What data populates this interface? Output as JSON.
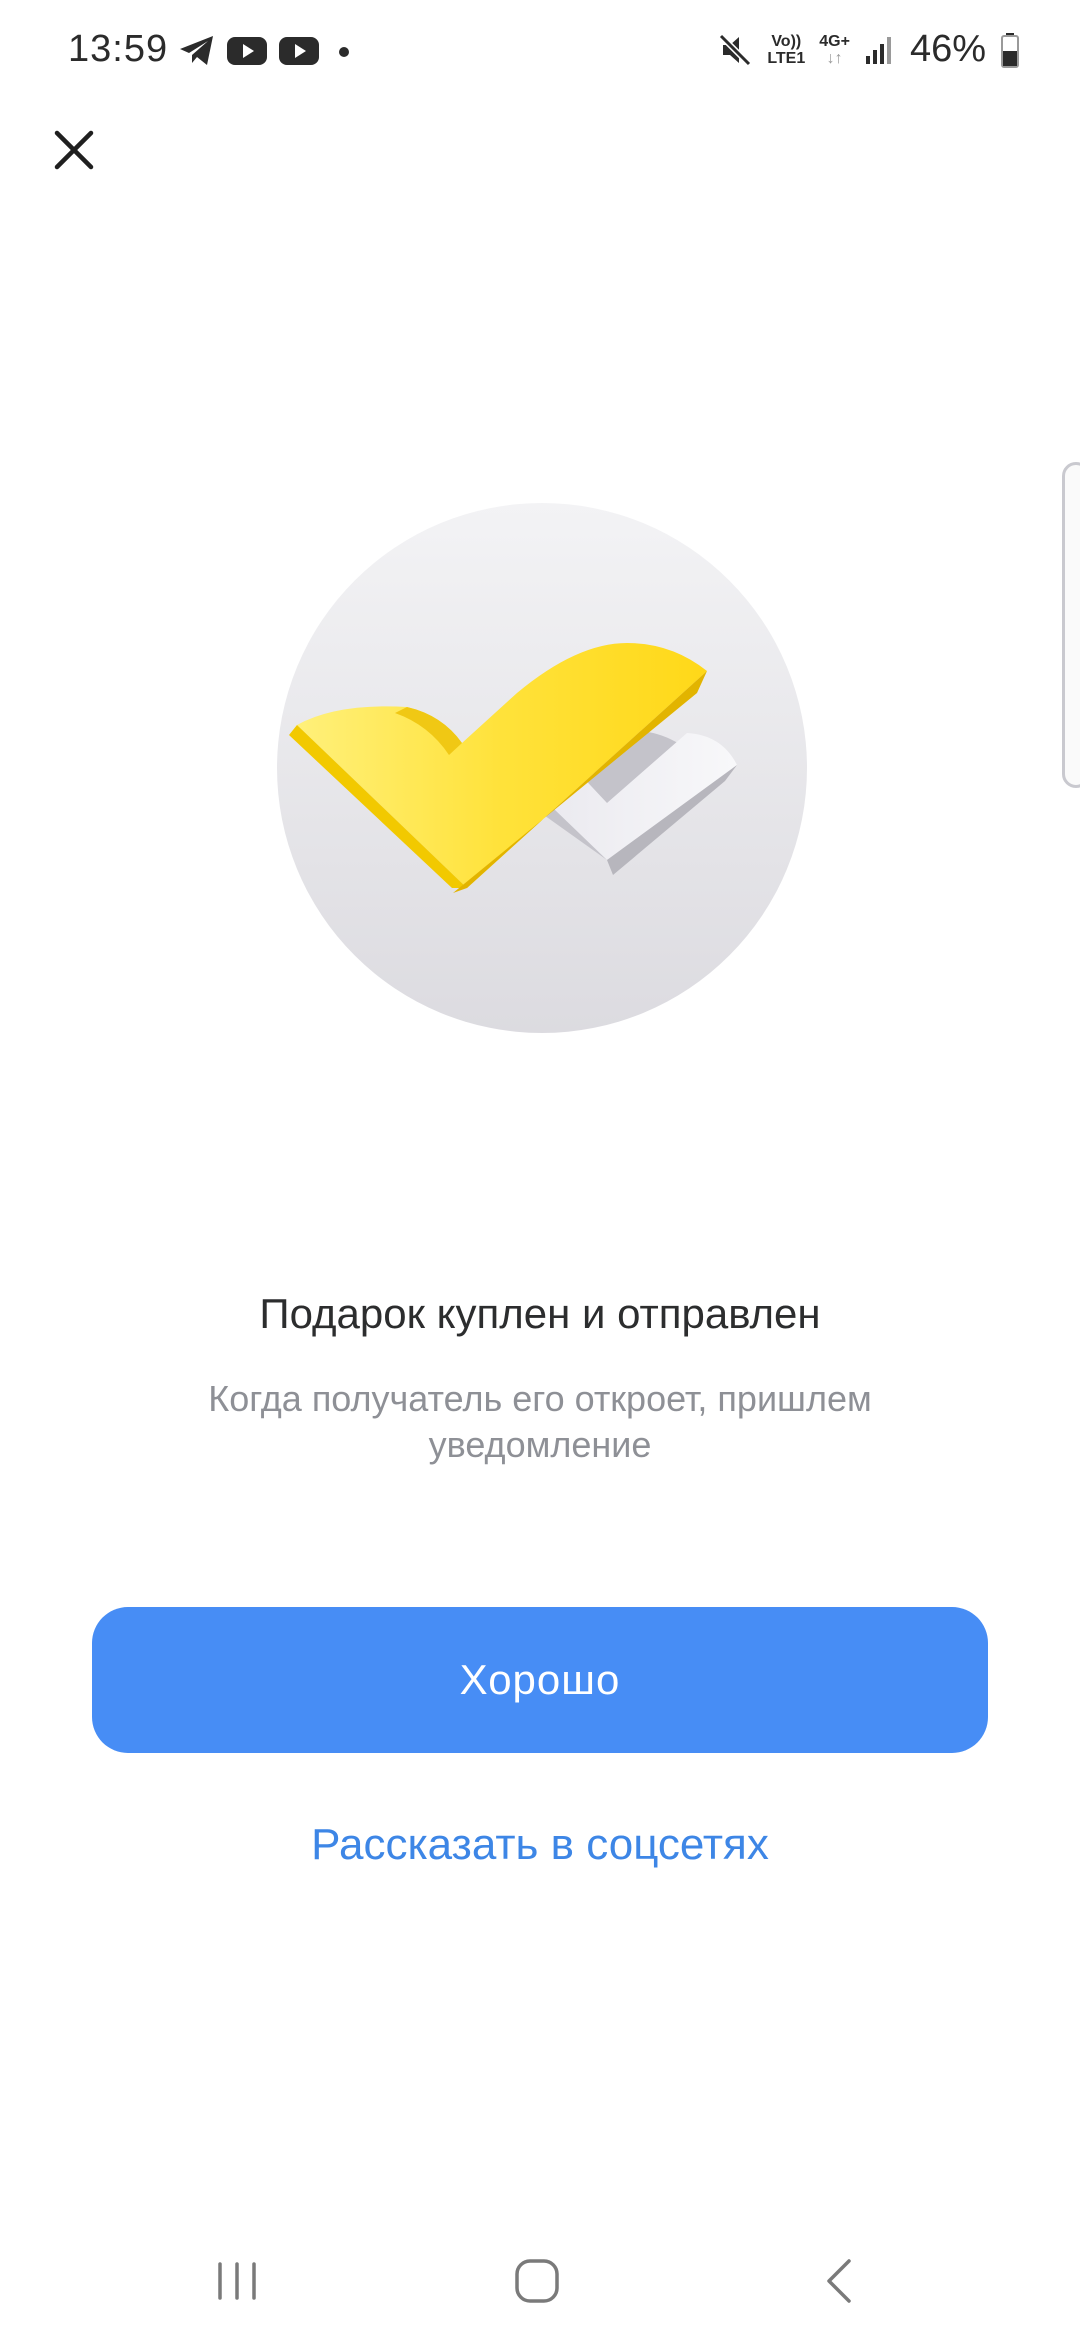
{
  "status_bar": {
    "time": "13:59",
    "notification_icons": [
      "telegram-icon",
      "youtube-icon",
      "youtube-icon",
      "dot-icon"
    ],
    "volte_label_top": "Vo))",
    "volte_label_bottom": "LTE1",
    "network_label": "4G+",
    "battery": "46%"
  },
  "dialog": {
    "close_icon": "close-icon",
    "illustration": "double-checkmark-illustration",
    "title": "Подарок куплен и отправлен",
    "subtitle": "Когда получатель его откроет, пришлем уведомление",
    "primary_button": "Хорошо",
    "secondary_link": "Рассказать в соцсетях"
  },
  "colors": {
    "primary": "#478df5",
    "link": "#3d86e6",
    "title": "#2c2d2e",
    "subtitle": "#8e9096",
    "check_yellow": "#ffd92b",
    "check_gray": "#d7d6dc"
  },
  "nav_bar": {
    "icons": [
      "recent-apps-icon",
      "home-icon",
      "back-icon"
    ]
  }
}
